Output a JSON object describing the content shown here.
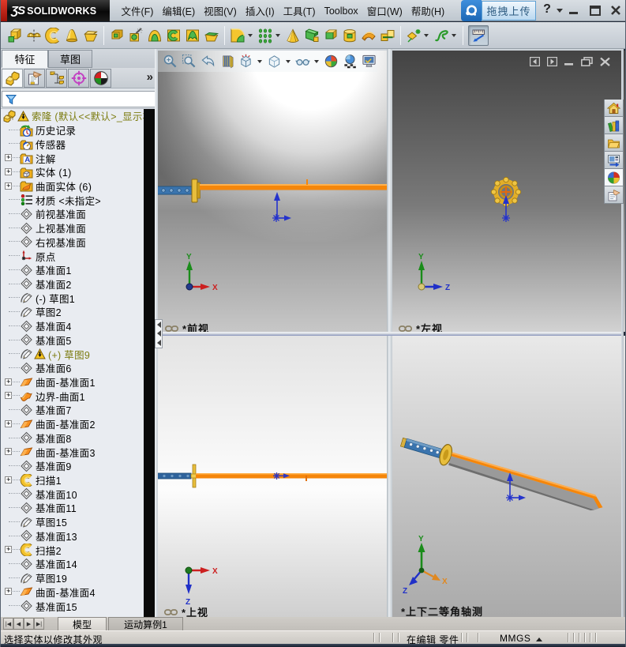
{
  "colors": {
    "blade-orange": "#f5860a",
    "handle-blue": "#3a74ae",
    "guard-gold": "#e8b83a",
    "origin-blue": "#2433cc",
    "axis-red": "#cc2020",
    "axis-green": "#1a8c1a",
    "axis-blue": "#2030c8",
    "axis-orange": "#e08820",
    "warn-olive": "#7c7c10",
    "upload-blue": "#2b7fd4"
  },
  "titlebar": {
    "logo_ds": "ƷS",
    "logo_name": "SOLIDWORKS",
    "menus": [
      {
        "label": "文件(F)",
        "name": "menu-file"
      },
      {
        "label": "编辑(E)",
        "name": "menu-edit"
      },
      {
        "label": "视图(V)",
        "name": "menu-view"
      },
      {
        "label": "插入(I)",
        "name": "menu-insert"
      },
      {
        "label": "工具(T)",
        "name": "menu-tools"
      },
      {
        "label": "Toolbox",
        "name": "menu-toolbox"
      },
      {
        "label": "窗口(W)",
        "name": "menu-window"
      },
      {
        "label": "帮助(H)",
        "name": "menu-help"
      }
    ],
    "upload_label": "拖拽上传",
    "help_glyph": "?"
  },
  "toolbar": {
    "items": [
      {
        "kind": "icon",
        "icon": "tb-extrude",
        "name": "toolbar-extruded-boss"
      },
      {
        "kind": "icon",
        "icon": "tb-revolve",
        "name": "toolbar-revolved-boss"
      },
      {
        "kind": "icon",
        "icon": "tb-sweep",
        "name": "toolbar-swept-boss"
      },
      {
        "kind": "icon",
        "icon": "tb-dome",
        "name": "toolbar-lofted-boss"
      },
      {
        "kind": "icon",
        "icon": "tb-wrapbox",
        "name": "toolbar-boundary-boss"
      },
      {
        "kind": "sep",
        "sep_only": true
      },
      {
        "kind": "icon",
        "icon": "tb-cuthole",
        "name": "toolbar-extruded-cut"
      },
      {
        "kind": "icon",
        "icon": "tb-wizard",
        "name": "toolbar-hole-wizard"
      },
      {
        "kind": "icon",
        "icon": "tb-arch",
        "name": "toolbar-revolved-cut"
      },
      {
        "kind": "icon",
        "icon": "tb-cutc",
        "name": "toolbar-swept-cut"
      },
      {
        "kind": "icon",
        "icon": "tb-tent",
        "name": "toolbar-lofted-cut"
      },
      {
        "kind": "icon",
        "icon": "tb-lid",
        "name": "toolbar-boundary-cut"
      },
      {
        "kind": "sep",
        "sep_only": true
      },
      {
        "kind": "icon",
        "icon": "tb-fillet",
        "name": "toolbar-fillet",
        "dd": true
      },
      {
        "kind": "icon",
        "icon": "tb-pattern",
        "name": "toolbar-linear-pattern",
        "dd": true
      },
      {
        "kind": "icon",
        "icon": "tb-draft",
        "name": "toolbar-draft"
      },
      {
        "kind": "icon",
        "icon": "tb-wedge",
        "name": "toolbar-chamfer"
      },
      {
        "kind": "icon",
        "icon": "tb-shell",
        "name": "toolbar-shell"
      },
      {
        "kind": "icon",
        "icon": "tb-cyl",
        "name": "toolbar-wrap"
      },
      {
        "kind": "icon",
        "icon": "tb-flex",
        "name": "toolbar-flex"
      },
      {
        "kind": "icon",
        "icon": "tb-combine",
        "name": "toolbar-combine"
      },
      {
        "kind": "sep",
        "sep_only": true
      },
      {
        "kind": "icon",
        "icon": "tb-freeform",
        "name": "toolbar-instant3d",
        "dd": true
      },
      {
        "kind": "icon",
        "icon": "tb-spline",
        "name": "toolbar-curves",
        "dd": true
      },
      {
        "kind": "sep",
        "sep_only": true
      },
      {
        "kind": "icon",
        "icon": "tb-measure",
        "name": "toolbar-instant3d-toggle",
        "pressed": true
      }
    ]
  },
  "left_panel": {
    "tabs": [
      {
        "label": "特征",
        "name": "tab-features",
        "active": true
      },
      {
        "label": "草图",
        "name": "tab-sketch",
        "active": false
      }
    ],
    "managers": [
      {
        "icon": "mgr-feat",
        "name": "featuremanager-tab",
        "active": true
      },
      {
        "icon": "mgr-prop",
        "name": "propertymanager-tab"
      },
      {
        "icon": "mgr-config",
        "name": "configurationmanager-tab"
      },
      {
        "icon": "mgr-dimx",
        "name": "dimxpertmanager-tab"
      },
      {
        "icon": "mgr-disp",
        "name": "displaymanager-tab"
      }
    ],
    "chevron": "»",
    "expand_glyph": "+",
    "tree": [
      {
        "label": "索隆   (默认<<默认>_显示状态",
        "icon": "part",
        "root": true,
        "warn": true,
        "olive": true
      },
      {
        "label": "历史记录",
        "icon": "history"
      },
      {
        "label": "传感器",
        "icon": "sensors"
      },
      {
        "label": "注解",
        "icon": "ann",
        "expand": true
      },
      {
        "label": "实体 (1)",
        "icon": "solids",
        "expand": true
      },
      {
        "label": "曲面实体 (6)",
        "icon": "surfbodies",
        "expand": true
      },
      {
        "label": "材质 <未指定>",
        "icon": "material"
      },
      {
        "label": "前视基准面",
        "icon": "plane"
      },
      {
        "label": "上视基准面",
        "icon": "plane"
      },
      {
        "label": "右视基准面",
        "icon": "plane"
      },
      {
        "label": "原点",
        "icon": "origin"
      },
      {
        "label": "基准面1",
        "icon": "plane"
      },
      {
        "label": "基准面2",
        "icon": "plane"
      },
      {
        "label": "(-) 草图1",
        "icon": "sketch"
      },
      {
        "label": "草图2",
        "icon": "sketch"
      },
      {
        "label": "基准面4",
        "icon": "plane"
      },
      {
        "label": "基准面5",
        "icon": "plane"
      },
      {
        "label": "(+) 草图9",
        "icon": "sketch",
        "warn": true,
        "olive": true
      },
      {
        "label": "基准面6",
        "icon": "plane"
      },
      {
        "label": "曲面-基准面1",
        "icon": "surfplane",
        "expand": true
      },
      {
        "label": "边界-曲面1",
        "icon": "boundary",
        "expand": true
      },
      {
        "label": "基准面7",
        "icon": "plane"
      },
      {
        "label": "曲面-基准面2",
        "icon": "surfplane",
        "expand": true
      },
      {
        "label": "基准面8",
        "icon": "plane"
      },
      {
        "label": "曲面-基准面3",
        "icon": "surfplane",
        "expand": true
      },
      {
        "label": "基准面9",
        "icon": "plane"
      },
      {
        "label": "扫描1",
        "icon": "sweep",
        "expand": true
      },
      {
        "label": "基准面10",
        "icon": "plane"
      },
      {
        "label": "基准面11",
        "icon": "plane"
      },
      {
        "label": "草图15",
        "icon": "sketch"
      },
      {
        "label": "基准面13",
        "icon": "plane"
      },
      {
        "label": "扫描2",
        "icon": "sweep",
        "expand": true
      },
      {
        "label": "基准面14",
        "icon": "plane"
      },
      {
        "label": "草图19",
        "icon": "sketch"
      },
      {
        "label": "曲面-基准面4",
        "icon": "surfplane",
        "expand": true
      },
      {
        "label": "基准面15",
        "icon": "plane"
      }
    ]
  },
  "headsup": {
    "items": [
      {
        "icon": "hu-zoomfit",
        "name": "zoom-to-fit-button"
      },
      {
        "icon": "hu-zoomarea",
        "name": "zoom-to-area-button"
      },
      {
        "icon": "hu-prev",
        "name": "previous-view-button"
      },
      {
        "icon": "hu-section",
        "name": "section-view-button"
      },
      {
        "icon": "hu-orient",
        "name": "view-orientation-button",
        "dd": true
      },
      {
        "icon": "hu-style",
        "name": "display-style-button",
        "dd": true
      },
      {
        "icon": "hu-hide",
        "name": "hide-show-items-button",
        "dd": true
      },
      {
        "icon": "hu-appearance",
        "name": "edit-appearance-button"
      },
      {
        "icon": "hu-scene",
        "name": "apply-scene-button"
      },
      {
        "icon": "hu-settings",
        "name": "view-settings-button"
      }
    ]
  },
  "viewports": {
    "front": {
      "caption": "*前视",
      "axis_v": "Y",
      "axis_h": "X"
    },
    "left": {
      "caption": "*左视",
      "axis_v": "Y",
      "axis_h": "Z"
    },
    "top": {
      "caption": "*上视",
      "axis_h": "X",
      "axis_d": "Z"
    },
    "iso": {
      "caption": "*上下二等角轴测",
      "axis_v": "Y",
      "axis_l": "Z",
      "axis_r": "X"
    }
  },
  "taskpane": [
    {
      "icon": "tp-home",
      "name": "solidworks-resources-tab"
    },
    {
      "icon": "tp-books",
      "name": "design-library-tab"
    },
    {
      "icon": "tp-folder",
      "name": "file-explorer-tab"
    },
    {
      "icon": "tp-palette",
      "name": "view-palette-tab"
    },
    {
      "icon": "tp-sphere",
      "name": "appearances-scenes-tab",
      "active": true
    },
    {
      "icon": "tp-props",
      "name": "custom-properties-tab"
    }
  ],
  "bottom": {
    "model_tabs": [
      {
        "label": "模型",
        "name": "tab-model",
        "active": true
      },
      {
        "label": "运动算例1",
        "name": "tab-motion-study-1",
        "active": false
      }
    ],
    "status_hint": "选择实体以修改其外观",
    "status_mode": "在编辑 零件",
    "status_units": "MMGS",
    "nav": [
      "|◀",
      "◀",
      "▶",
      "▶|"
    ]
  }
}
